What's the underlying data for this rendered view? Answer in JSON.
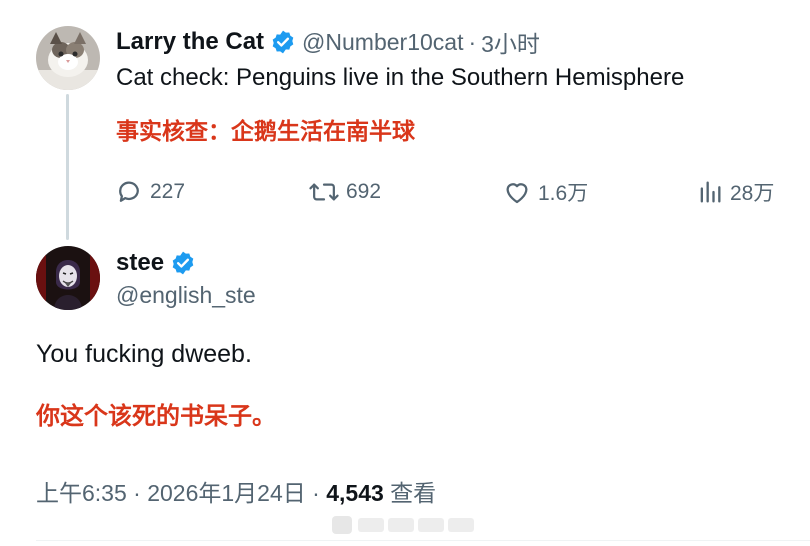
{
  "quoted_tweet": {
    "author_name": "Larry the Cat",
    "author_handle": "@Number10cat",
    "separator": "·",
    "time_ago": "3小时",
    "text": "Cat check: Penguins live in the Southern Hemisphere",
    "translation": "事实核查：企鹅生活在南半球",
    "stats": {
      "replies": "227",
      "retweets": "692",
      "likes": "1.6万",
      "views": "28万"
    }
  },
  "reply_tweet": {
    "author_name": "stee",
    "author_handle": "@english_ste",
    "text": "You fucking dweeb.",
    "translation": "你这个该死的书呆子。",
    "time": "上午6:35",
    "date": "2026年1月24日",
    "views_count": "4,543",
    "views_label": "查看"
  },
  "colors": {
    "verified": "#1d9bf0",
    "translation_red": "#d9361a",
    "secondary_text": "#536471"
  },
  "icons": [
    "verified-badge-icon",
    "reply-icon",
    "retweet-icon",
    "like-icon",
    "views-icon"
  ]
}
